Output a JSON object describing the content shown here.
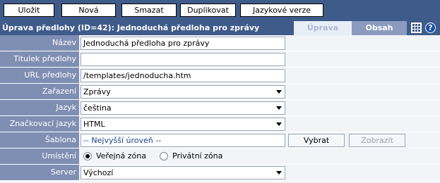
{
  "toolbar": {
    "save": "Uložit",
    "new": "Nová",
    "delete": "Smazat",
    "duplicate": "Duplikovat",
    "lang_versions": "Jazykové verze"
  },
  "header": {
    "title": "Úprava předlohy (ID=42): Jednoduchá předloha pro zprávy",
    "tab_edit": "Úprava",
    "tab_content": "Obsah",
    "help_glyph": "?"
  },
  "form": {
    "name_label": "Název",
    "name_value": "Jednoduchá předloha pro zprávy",
    "caption_label": "Titulek předlohy",
    "caption_value": "",
    "url_label": "URL předlohy",
    "url_value": "/templates/jednoducha.htm",
    "category_label": "Zařazení",
    "category_value": "Zprávy",
    "language_label": "Jazyk",
    "language_value": "čeština",
    "markup_label": "Značkovací jazyk",
    "markup_value": "HTML",
    "template_label": "Šablona",
    "template_value": "-- Nejvyšší úroveň --",
    "select_button": "Vybrat",
    "show_button": "Zobrazit",
    "placement_label": "Umístění",
    "public_zone": "Veřejná zóna",
    "private_zone": "Privátní zóna",
    "server_label": "Server",
    "server_value": "Výchozí"
  }
}
